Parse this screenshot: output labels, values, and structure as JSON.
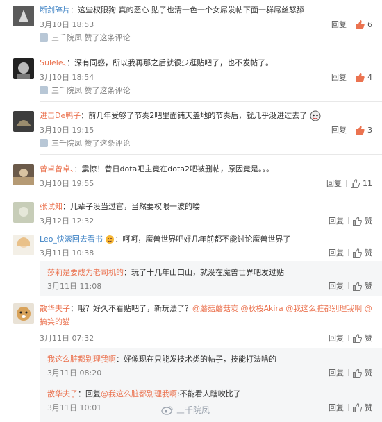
{
  "comments": [
    {
      "user": "断剑碎片",
      "sep": "：",
      "text": "这些权限狗 真的恶心 贴子也清一色一个女屌发帖下面一群屌丝怒舔",
      "time": "3月10日 18:53",
      "reply": "回复",
      "likes": "6",
      "liked_by": "三千院凤 赞了这条评论"
    },
    {
      "user": "Sulele、",
      "sep": "：",
      "text": "深有同感，所以我再那之后就很少逛贴吧了，也不发帖了。",
      "time": "3月10日 18:54",
      "reply": "回复",
      "likes": "4",
      "liked_by": "三千院凤 赞了这条评论"
    },
    {
      "user": "进击De鸭子",
      "sep": "：",
      "text": "前几年受够了节奏2吧里面铺天盖地的节奏后，就几乎没进过去了",
      "time": "3月10日 19:15",
      "reply": "回复",
      "likes": "3",
      "liked_by": "三千院凤 赞了这条评论"
    },
    {
      "user": "曾卓曾卓、",
      "sep": "：",
      "text": "震惊！昔日dota吧主竟在dota2吧被删帖，原因竟是。。。",
      "time": "3月10日 19:55",
      "reply": "回复",
      "likes": "11"
    },
    {
      "user": "张试知",
      "sep": "：",
      "text": "儿辈子没当过官，当然要权限一波的喽",
      "time": "3月12日 12:32",
      "reply": "回复",
      "likes": "赞"
    },
    {
      "user": "Leo_快滚回去看书",
      "sep": "：呵呵，",
      "text": "魔兽世界吧好几年前都不能讨论魔兽世界了",
      "time": "3月11日 10:38",
      "reply": "回复",
      "likes": "赞"
    },
    {
      "user": "散华夫子",
      "sep": "：",
      "text": "哦？好久不看贴吧了，新玩法了？",
      "mentions": "@蘑菇蘑菇炭 @秋桜Akira @我这么脏都别理我啊 @",
      "line2": "搞笑的猫",
      "time": "3月11日 07:32",
      "reply": "回复",
      "likes": "赞"
    }
  ],
  "sub_replies": [
    {
      "user": "莎莉是要成为老司机的",
      "sep": "：",
      "text": "玩了十几年山口山，就没在魔兽世界吧发过贴",
      "time": "3月11日 11:08",
      "reply": "回复",
      "likes": "赞"
    },
    {
      "user": "我这么脏都别理我啊",
      "sep": "：",
      "text": "好像现在只能发技术类的帖子，技能打法啥的",
      "time": "3月11日 08:20",
      "reply": "回复",
      "likes": "赞"
    },
    {
      "user": "散华夫子",
      "sep": "：",
      "text": "回复",
      "mention": "@我这么脏都别理我啊",
      "tail": ":不能看人瞎吹比了",
      "time": "3月11日 10:01",
      "reply": "回复",
      "likes": "赞"
    }
  ],
  "watermark": "三千院凤",
  "colors": {
    "accent": "#eb7350",
    "link": "#3f83c5"
  }
}
